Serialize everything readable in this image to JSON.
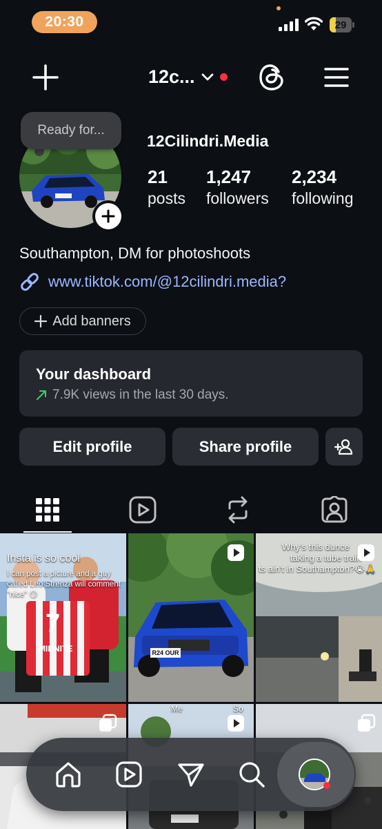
{
  "status_bar": {
    "time": "20:30",
    "battery": "29",
    "battery_percent": 29
  },
  "header": {
    "username": "12c...",
    "icons": [
      "plus-icon",
      "chevron-down-icon",
      "threads-icon",
      "menu-icon"
    ]
  },
  "profile": {
    "note": "Ready for...",
    "display_name": "12Cilindri.Media",
    "stats": [
      {
        "value": "21",
        "label": "posts"
      },
      {
        "value": "1,247",
        "label": "followers"
      },
      {
        "value": "2,234",
        "label": "following"
      }
    ],
    "bio": "Southampton, DM for photoshoots",
    "link": "www.tiktok.com/@12cilindri.media?",
    "add_banners": "Add banners"
  },
  "dashboard": {
    "title": "Your dashboard",
    "subtitle": "7.9K views in the last 30 days."
  },
  "actions": {
    "edit_profile": "Edit profile",
    "share_profile": "Share profile"
  },
  "tabs": [
    "grid-tab",
    "reels-tab",
    "reposts-tab",
    "tagged-tab"
  ],
  "grid": {
    "post_1": {
      "title": "Insta is so cool",
      "caption": "I can post a picture and a guy called Leo Strenza will comment \"nice\" 😏",
      "shirt_text": "MIDNITE",
      "shirt_number": "7"
    },
    "post_2": {
      "plate": "R24 OUR"
    },
    "post_3": {
      "caption_line1": "Why's this dunce",
      "caption_line2": "taking a tube train",
      "caption_line3": "ts ain't in Southampton?😭🙏"
    },
    "post_5": {
      "overlay": "Me"
    },
    "post_6": {
      "overlay": "So"
    }
  },
  "bottom_nav": [
    "home-icon",
    "reels-icon",
    "send-icon",
    "search-icon",
    "profile-avatar"
  ],
  "colors": {
    "background": "#0c0f14",
    "accent_link": "#9cb7ff",
    "time_pill": "#f0a35c",
    "notification": "#ff2d3f",
    "trend_green": "#3ecf6a"
  }
}
